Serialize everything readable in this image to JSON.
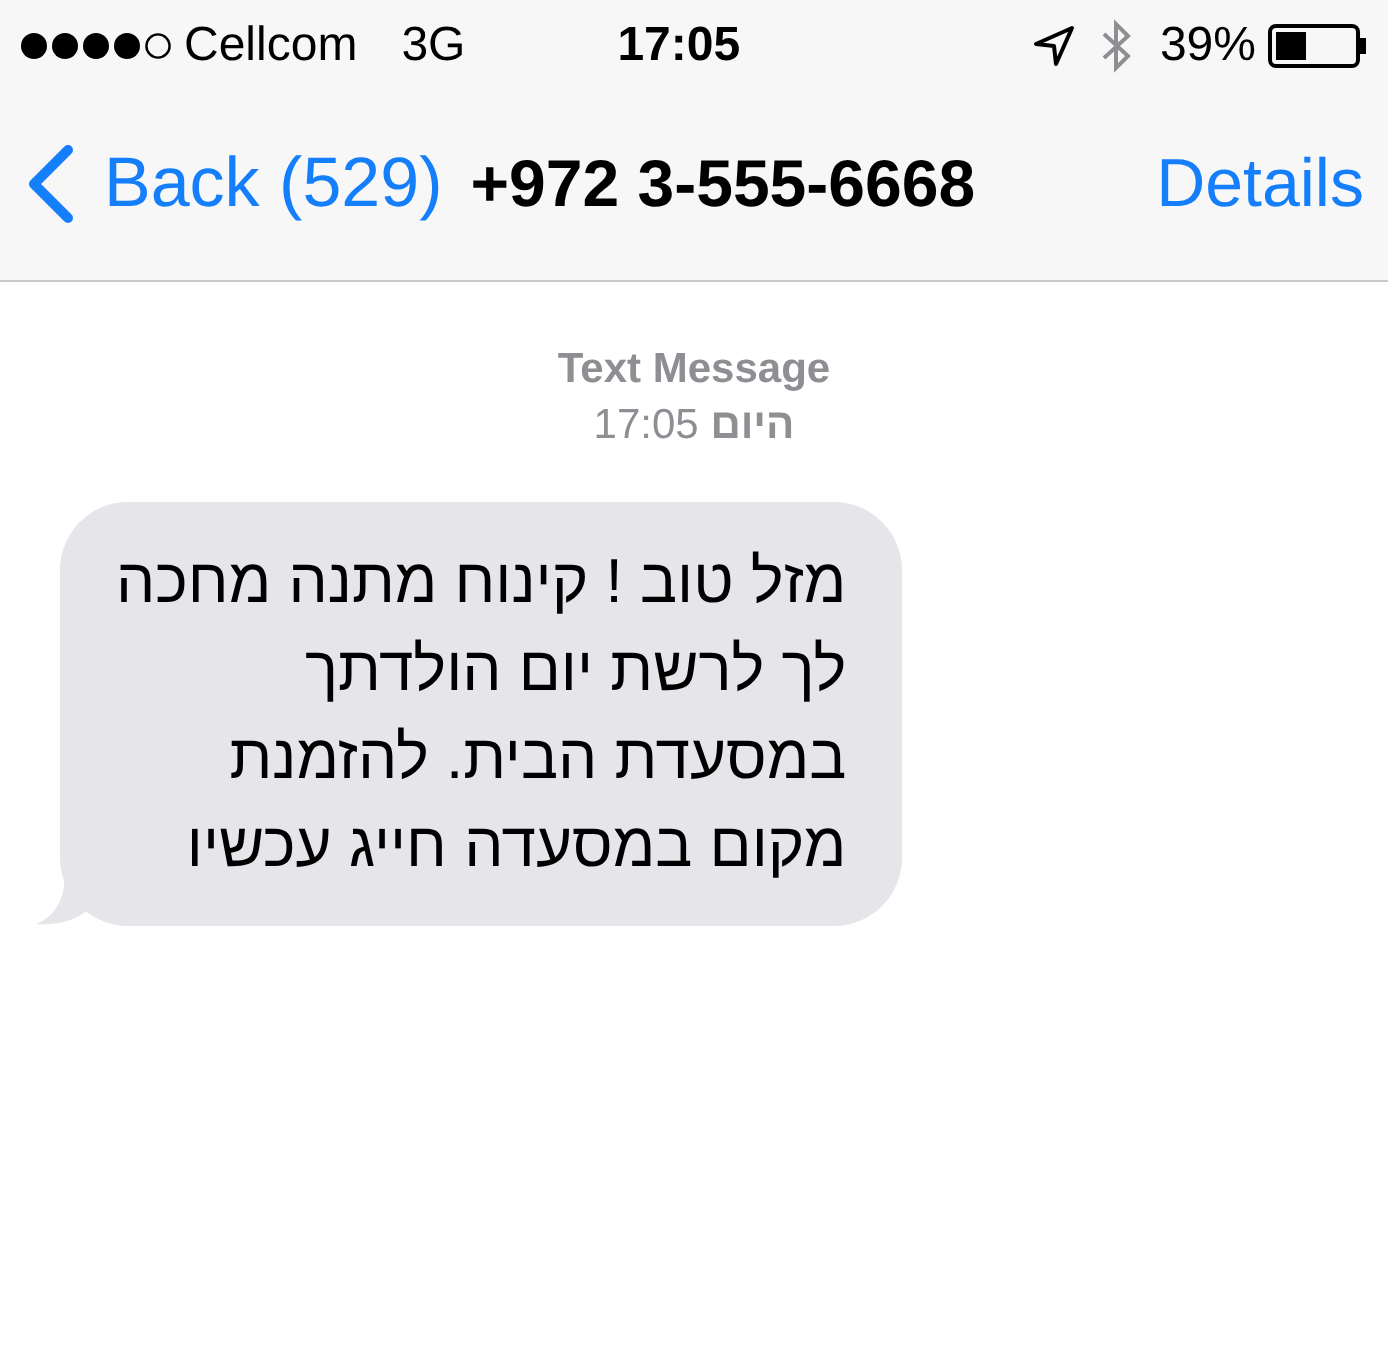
{
  "status_bar": {
    "carrier": "Cellcom",
    "network": "3G",
    "time": "17:05",
    "battery": "39%"
  },
  "nav_bar": {
    "back": "Back (529)",
    "title": "+972 3-555-6668",
    "action": "Details"
  },
  "thread": {
    "label": "Text Message",
    "timestamp": "**היום** 17:05"
  },
  "messages": [
    {
      "kind": "incoming",
      "text": "מזל טוב ! קינוח מתנה מחכה\nלך לרשת יום הולדתך\nבמסעדת הבית. להזמנת\nמקום במסעדה חייג עכשיו"
    }
  ]
}
